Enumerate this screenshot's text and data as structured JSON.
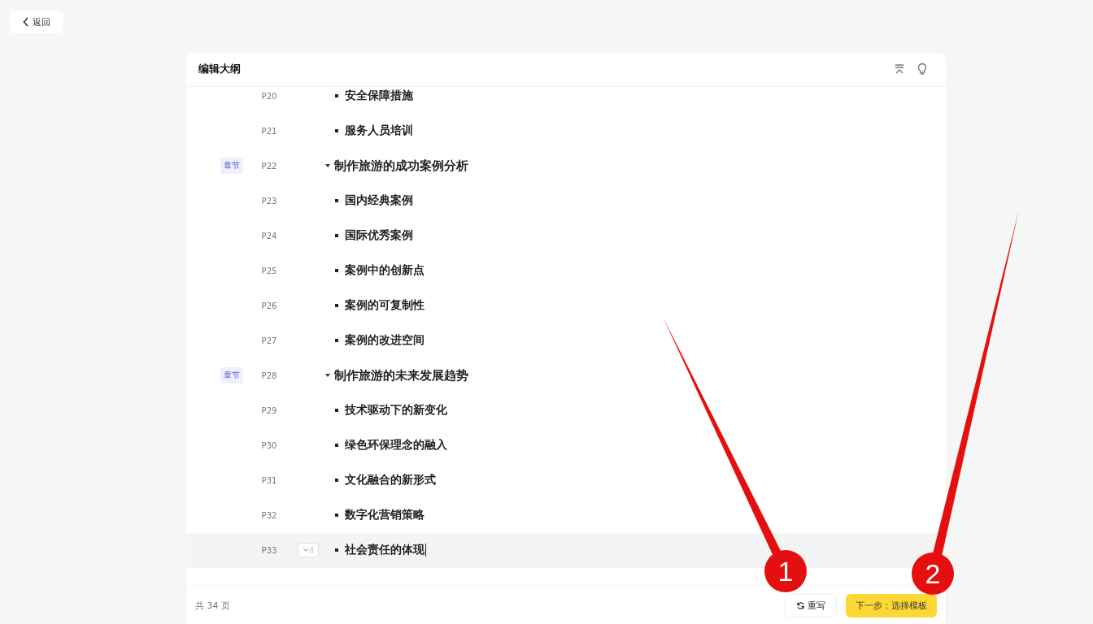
{
  "back_button": {
    "label": "返回"
  },
  "editor": {
    "title": "编辑大纲",
    "rows": [
      {
        "kind": "item",
        "page": "P20",
        "title": "安全保障措施",
        "highlighted": false
      },
      {
        "kind": "item",
        "page": "P21",
        "title": "服务人员培训",
        "highlighted": false
      },
      {
        "kind": "chapter",
        "tag": "章节",
        "page": "P22",
        "title": "制作旅游的成功案例分析",
        "highlighted": false
      },
      {
        "kind": "item",
        "page": "P23",
        "title": "国内经典案例",
        "highlighted": false
      },
      {
        "kind": "item",
        "page": "P24",
        "title": "国际优秀案例",
        "highlighted": false
      },
      {
        "kind": "item",
        "page": "P25",
        "title": "案例中的创新点",
        "highlighted": false
      },
      {
        "kind": "item",
        "page": "P26",
        "title": "案例的可复制性",
        "highlighted": false
      },
      {
        "kind": "item",
        "page": "P27",
        "title": "案例的改进空间",
        "highlighted": false
      },
      {
        "kind": "chapter",
        "tag": "章节",
        "page": "P28",
        "title": "制作旅游的未来发展趋势",
        "highlighted": false
      },
      {
        "kind": "item",
        "page": "P29",
        "title": "技术驱动下的新变化",
        "highlighted": false
      },
      {
        "kind": "item",
        "page": "P30",
        "title": "绿色环保理念的融入",
        "highlighted": false
      },
      {
        "kind": "item",
        "page": "P31",
        "title": "文化融合的新形式",
        "highlighted": false
      },
      {
        "kind": "item",
        "page": "P32",
        "title": "数字化营销策略",
        "highlighted": false
      },
      {
        "kind": "item",
        "page": "P33",
        "title": "社会责任的体现",
        "highlighted": true
      }
    ],
    "footer": {
      "page_count": "共 34 页",
      "rewrite_button": "重写",
      "next_button": "下一步：选择模板"
    }
  },
  "callouts": [
    {
      "number": "1"
    },
    {
      "number": "2"
    }
  ]
}
